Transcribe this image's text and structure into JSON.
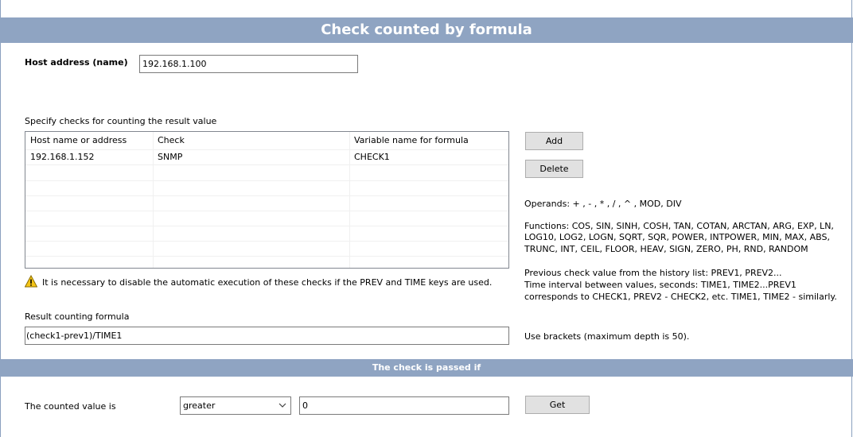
{
  "title": "Check counted by formula",
  "host": {
    "label": "Host address (name)",
    "value": "192.168.1.100"
  },
  "checks": {
    "label": "Specify checks for counting the result value",
    "columns": [
      "Host name or address",
      "Check",
      "Variable name for formula"
    ],
    "rows": [
      {
        "host": "192.168.1.152",
        "check": "SNMP",
        "variable": "CHECK1"
      }
    ]
  },
  "buttons": {
    "add": "Add",
    "delete": "Delete",
    "get": "Get"
  },
  "help": {
    "operands": "Operands: + , - , * , / , ^ , MOD, DIV",
    "functions_1": "Functions: COS, SIN, SINH, COSH, TAN, COTAN, ARCTAN, ARG, EXP, LN,",
    "functions_2": "LOG10, LOG2, LOGN, SQRT, SQR, POWER, INTPOWER, MIN, MAX, ABS,",
    "functions_3": "TRUNC, INT, CEIL, FLOOR, HEAV, SIGN, ZERO, PH, RND, RANDOM",
    "previous_1": "Previous check value from the history list: PREV1, PREV2...",
    "previous_2": "Time interval between values, seconds: TIME1, TIME2...PREV1",
    "previous_3": "corresponds to CHECK1, PREV2 - CHECK2, etc. TIME1, TIME2 - similarly.",
    "brackets": "Use brackets (maximum depth is 50)."
  },
  "warning": "It is necessary to disable the automatic execution of these checks if the PREV and TIME keys are used.",
  "formula": {
    "label": "Result counting formula",
    "value": "(check1-prev1)/TIME1"
  },
  "pass": {
    "header": "The check is passed if",
    "label": "The counted value is",
    "comparison": "greater",
    "threshold": "0"
  },
  "colors": {
    "header_bar": "#8fa4c2",
    "warning": "#f5c518"
  }
}
